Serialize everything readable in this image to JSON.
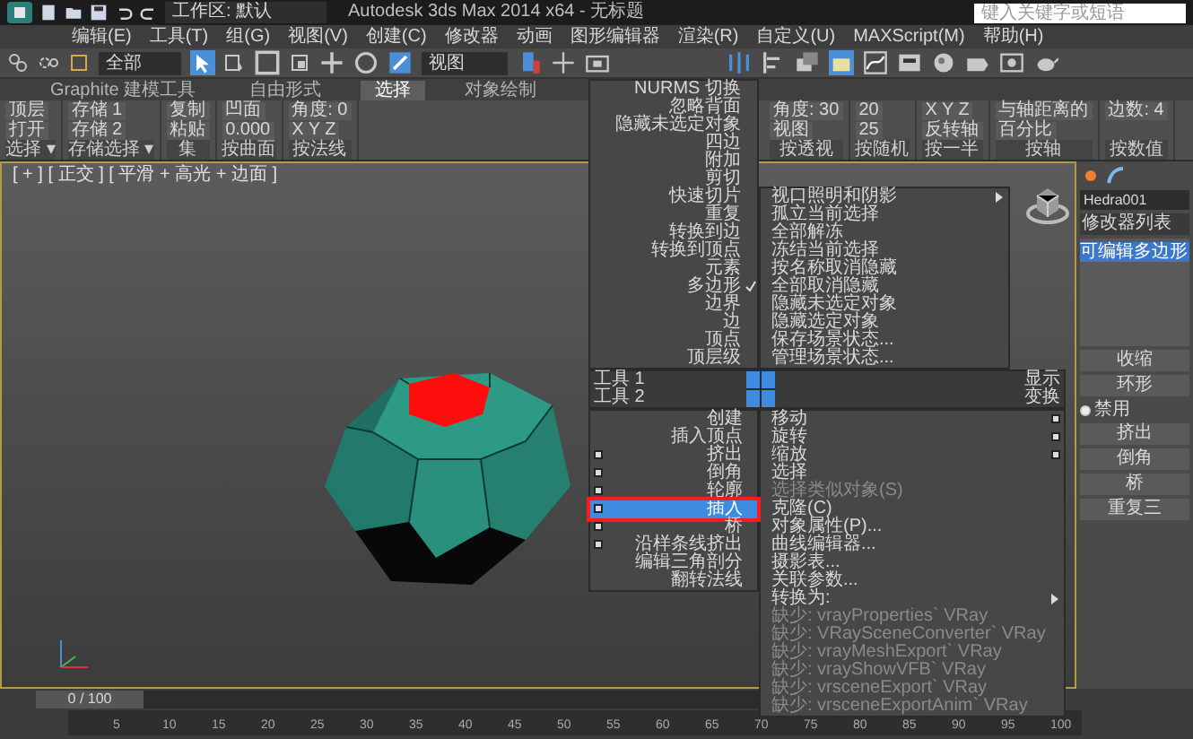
{
  "title_bar": {
    "workspace": "工作区: 默认",
    "title": "Autodesk 3ds Max 2014 x64 - 无标题",
    "search": {
      "placeholder": "键入关键字或短语"
    }
  },
  "menu_bar": [
    "编辑(E)",
    "工具(T)",
    "组(G)",
    "视图(V)",
    "创建(C)",
    "修改器",
    "动画",
    "图形编辑器",
    "渲染(R)",
    "自定义(U)",
    "MAXScript(M)",
    "帮助(H)"
  ],
  "toolbar": {
    "selection_filter": "全部",
    "reference_coordinate": "视图"
  },
  "ribbon": {
    "tabs": [
      {
        "label": "Graphite 建模工具",
        "selected": false
      },
      {
        "label": "自由形式",
        "selected": false
      },
      {
        "label": "选择",
        "selected": true
      },
      {
        "label": "对象绘制",
        "selected": false
      }
    ],
    "groups": [
      {
        "label": "选择 ▾",
        "items": [
          "顶层",
          "打开"
        ]
      },
      {
        "label": "存储选择 ▾",
        "items": [
          "存储 1",
          "存储 2"
        ]
      },
      {
        "label": "集",
        "items": [
          "复制",
          "粘贴"
        ]
      },
      {
        "label": "按曲面",
        "items": [
          "凹面",
          "0.000"
        ]
      },
      {
        "label": "按法线",
        "items": [
          "角度: 0",
          "X Y Z"
        ]
      },
      {
        "label": "按透视",
        "items": [
          "角度: 30",
          "视图"
        ]
      },
      {
        "label": "按随机",
        "items": [
          "20",
          "25"
        ]
      },
      {
        "label": "按一半",
        "items": [
          "X Y Z",
          "反转轴"
        ]
      },
      {
        "label": "按轴",
        "items": [
          "与轴距离的",
          "百分比"
        ]
      },
      {
        "label": "按数值",
        "items": [
          "边数: 4"
        ]
      }
    ]
  },
  "viewport": {
    "label": "[ + ] [ 正交 ] [ 平滑 + 高光 + 边面 ]"
  },
  "quad_menu": {
    "top_left": [
      {
        "label": "NURMS 切换",
        "checked": false
      },
      {
        "label": "忽略背面",
        "checked": false
      },
      {
        "label": "隐藏未选定对象",
        "checked": false
      },
      {
        "label": "四边",
        "checked": false
      },
      {
        "label": "附加",
        "checked": false
      },
      {
        "label": "剪切",
        "checked": false
      },
      {
        "label": "快速切片",
        "checked": false
      },
      {
        "label": "重复",
        "checked": false
      },
      {
        "label": "转换到边",
        "checked": false
      },
      {
        "label": "转换到顶点",
        "checked": false
      },
      {
        "label": "元素",
        "checked": false
      },
      {
        "label": "多边形",
        "checked": true
      },
      {
        "label": "边界",
        "checked": false
      },
      {
        "label": "边",
        "checked": false
      },
      {
        "label": "顶点",
        "checked": false
      },
      {
        "label": "顶层级",
        "checked": false
      }
    ],
    "top_right": [
      {
        "label": "视口照明和阴影",
        "submenu": true
      },
      {
        "label": "孤立当前选择",
        "submenu": false
      },
      {
        "label": "全部解冻",
        "submenu": false
      },
      {
        "label": "冻结当前选择",
        "submenu": false
      },
      {
        "label": "按名称取消隐藏",
        "submenu": false
      },
      {
        "label": "全部取消隐藏",
        "submenu": false
      },
      {
        "label": "隐藏未选定对象",
        "submenu": false
      },
      {
        "label": "隐藏选定对象",
        "submenu": false
      },
      {
        "label": "保存场景状态...",
        "submenu": false
      },
      {
        "label": "管理场景状态...",
        "submenu": false
      }
    ],
    "quadrant_labels": [
      {
        "left": "工具 1",
        "right": "显示"
      },
      {
        "left": "工具 2",
        "right": "变换"
      }
    ],
    "bottom_left": [
      {
        "label": "创建",
        "settings": false,
        "selected": false,
        "marked": false
      },
      {
        "label": "插入顶点",
        "settings": false,
        "selected": false,
        "marked": false
      },
      {
        "label": "挤出",
        "settings": true,
        "selected": false,
        "marked": false
      },
      {
        "label": "倒角",
        "settings": true,
        "selected": false,
        "marked": false
      },
      {
        "label": "轮廓",
        "settings": true,
        "selected": false,
        "marked": false
      },
      {
        "label": "插入",
        "settings": true,
        "selected": true,
        "marked": true
      },
      {
        "label": "桥",
        "settings": true,
        "selected": false,
        "marked": false
      },
      {
        "label": "沿样条线挤出",
        "settings": true,
        "selected": false,
        "marked": false
      },
      {
        "label": "编辑三角剖分",
        "settings": false,
        "selected": false,
        "marked": false
      },
      {
        "label": "翻转法线",
        "settings": false,
        "selected": false,
        "marked": false
      }
    ],
    "bottom_right": [
      {
        "label": "移动",
        "settings": true,
        "disabled": false,
        "submenu": false
      },
      {
        "label": "旋转",
        "settings": true,
        "disabled": false,
        "submenu": false
      },
      {
        "label": "缩放",
        "settings": true,
        "disabled": false,
        "submenu": false
      },
      {
        "label": "选择",
        "settings": false,
        "disabled": false,
        "submenu": false
      },
      {
        "label": "选择类似对象(S)",
        "settings": false,
        "disabled": true,
        "submenu": false
      },
      {
        "label": "克隆(C)",
        "settings": false,
        "disabled": false,
        "submenu": false
      },
      {
        "label": "对象属性(P)...",
        "settings": false,
        "disabled": false,
        "submenu": false
      },
      {
        "label": "曲线编辑器...",
        "settings": false,
        "disabled": false,
        "submenu": false
      },
      {
        "label": "摄影表...",
        "settings": false,
        "disabled": false,
        "submenu": false
      },
      {
        "label": "关联参数...",
        "settings": false,
        "disabled": false,
        "submenu": false
      },
      {
        "label": "转换为:",
        "settings": false,
        "disabled": false,
        "submenu": true
      },
      {
        "label": "缺少: vrayProperties` VRay",
        "settings": false,
        "disabled": true,
        "submenu": false
      },
      {
        "label": "缺少: VRaySceneConverter` VRay",
        "settings": false,
        "disabled": true,
        "submenu": false
      },
      {
        "label": "缺少: vrayMeshExport` VRay",
        "settings": false,
        "disabled": true,
        "submenu": false
      },
      {
        "label": "缺少: vrayShowVFB` VRay",
        "settings": false,
        "disabled": true,
        "submenu": false
      },
      {
        "label": "缺少: vrsceneExport` VRay",
        "settings": false,
        "disabled": true,
        "submenu": false
      },
      {
        "label": "缺少: vrsceneExportAnim` VRay",
        "settings": false,
        "disabled": true,
        "submenu": false
      }
    ]
  },
  "command_panel": {
    "object_name": "Hedra001",
    "modifier_list": "修改器列表",
    "stack_item": "可编辑多边形",
    "buttons_top": [
      "收缩",
      "环形"
    ],
    "radio": {
      "label": "禁用",
      "selected": true
    },
    "buttons_bottom": [
      "挤出",
      "倒角",
      "桥",
      "重复三"
    ]
  },
  "timeline": {
    "slider": "0 / 100",
    "ticks": [
      "5",
      "10",
      "15",
      "20",
      "25",
      "30",
      "35",
      "40",
      "45",
      "50",
      "55",
      "60",
      "65",
      "70",
      "75",
      "80",
      "85",
      "90",
      "95",
      "100"
    ]
  }
}
